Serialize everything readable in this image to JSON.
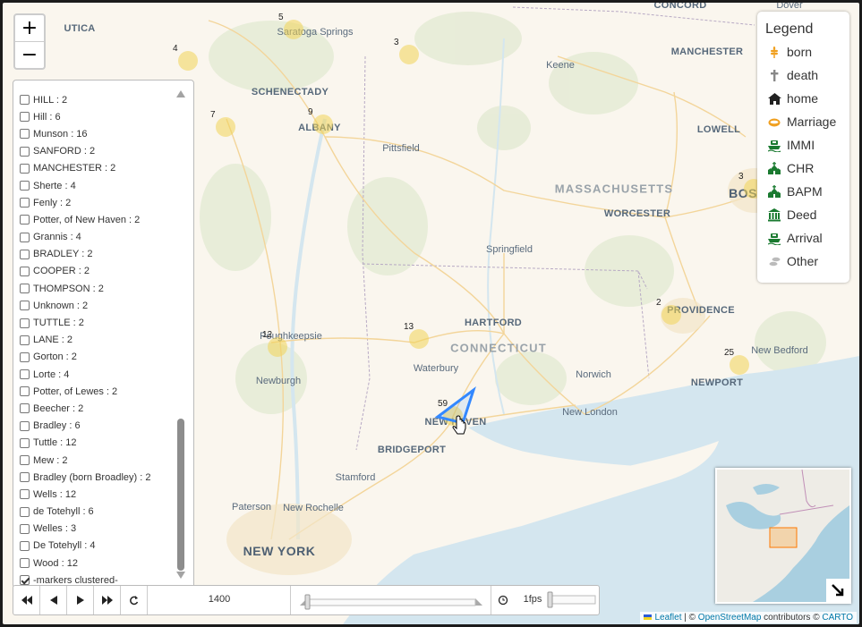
{
  "map": {
    "places": [
      {
        "id": "concord",
        "label": "CONCORD",
        "type": "big"
      },
      {
        "id": "utica",
        "label": "UTICA",
        "type": "big"
      },
      {
        "id": "saratoga-springs",
        "label": "Saratoga Springs",
        "type": "city"
      },
      {
        "id": "manchester",
        "label": "MANCHESTER",
        "type": "big"
      },
      {
        "id": "keene",
        "label": "Keene",
        "type": "city"
      },
      {
        "id": "schenectady",
        "label": "SCHENECTADY",
        "type": "big"
      },
      {
        "id": "albany",
        "label": "ALBANY",
        "type": "big"
      },
      {
        "id": "lowell",
        "label": "LOWELL",
        "type": "big"
      },
      {
        "id": "pittsfield",
        "label": "Pittsfield",
        "type": "city"
      },
      {
        "id": "massachusetts",
        "label": "MASSACHUSETTS",
        "type": "state"
      },
      {
        "id": "worcester",
        "label": "WORCESTER",
        "type": "big"
      },
      {
        "id": "bos",
        "label": "BOS",
        "type": "huge"
      },
      {
        "id": "springfield",
        "label": "Springfield",
        "type": "city"
      },
      {
        "id": "hartford",
        "label": "HARTFORD",
        "type": "big"
      },
      {
        "id": "providence",
        "label": "PROVIDENCE",
        "type": "big"
      },
      {
        "id": "poughkeepsie",
        "label": "Poughkeepsie",
        "type": "city"
      },
      {
        "id": "connecticut",
        "label": "CONNECTICUT",
        "type": "state"
      },
      {
        "id": "new-bedford",
        "label": "New Bedford",
        "type": "city"
      },
      {
        "id": "waterbury",
        "label": "Waterbury",
        "type": "city"
      },
      {
        "id": "newburgh",
        "label": "Newburgh",
        "type": "city"
      },
      {
        "id": "norwich",
        "label": "Norwich",
        "type": "city"
      },
      {
        "id": "newport",
        "label": "NEWPORT",
        "type": "big"
      },
      {
        "id": "new-haven",
        "label": "NEW HAVEN",
        "type": "big"
      },
      {
        "id": "new-london",
        "label": "New London",
        "type": "city"
      },
      {
        "id": "bridgeport",
        "label": "BRIDGEPORT",
        "type": "big"
      },
      {
        "id": "stamford",
        "label": "Stamford",
        "type": "city"
      },
      {
        "id": "paterson",
        "label": "Paterson",
        "type": "city"
      },
      {
        "id": "new-rochelle",
        "label": "New Rochelle",
        "type": "city"
      },
      {
        "id": "new-york",
        "label": "NEW YORK",
        "type": "huge"
      },
      {
        "id": "dover",
        "label": "Dover",
        "type": "city"
      }
    ],
    "clusters": [
      {
        "id": "saratoga",
        "count": "5"
      },
      {
        "id": "north",
        "count": "3"
      },
      {
        "id": "west-ny",
        "count": "4"
      },
      {
        "id": "albany-w",
        "count": "7"
      },
      {
        "id": "albany",
        "count": "9"
      },
      {
        "id": "boston",
        "count": "3"
      },
      {
        "id": "providence",
        "count": "2"
      },
      {
        "id": "hartford-s",
        "count": "13"
      },
      {
        "id": "poughkeepsie",
        "count": "12"
      },
      {
        "id": "newport",
        "count": "25"
      },
      {
        "id": "new-haven",
        "count": "59"
      }
    ]
  },
  "zoom": {
    "in_label": "+",
    "out_label": "−"
  },
  "layers": {
    "items": [
      {
        "label": "HILL : 2",
        "checked": false
      },
      {
        "label": "Hill : 6",
        "checked": false
      },
      {
        "label": "Munson : 16",
        "checked": false
      },
      {
        "label": "SANFORD : 2",
        "checked": false
      },
      {
        "label": "MANCHESTER : 2",
        "checked": false
      },
      {
        "label": "Sherte : 4",
        "checked": false
      },
      {
        "label": "Fenly : 2",
        "checked": false
      },
      {
        "label": "Potter, of New Haven : 2",
        "checked": false
      },
      {
        "label": "Grannis : 4",
        "checked": false
      },
      {
        "label": "BRADLEY : 2",
        "checked": false
      },
      {
        "label": "COOPER : 2",
        "checked": false
      },
      {
        "label": "THOMPSON : 2",
        "checked": false
      },
      {
        "label": "Unknown : 2",
        "checked": false
      },
      {
        "label": "TUTTLE : 2",
        "checked": false
      },
      {
        "label": "LANE : 2",
        "checked": false
      },
      {
        "label": "Gorton : 2",
        "checked": false
      },
      {
        "label": "Lorte : 4",
        "checked": false
      },
      {
        "label": "Potter, of Lewes : 2",
        "checked": false
      },
      {
        "label": "Beecher : 2",
        "checked": false
      },
      {
        "label": "Bradley : 6",
        "checked": false
      },
      {
        "label": "Tuttle : 12",
        "checked": false
      },
      {
        "label": "Mew : 2",
        "checked": false
      },
      {
        "label": "Bradley (born Broadley) : 2",
        "checked": false
      },
      {
        "label": "Wells : 12",
        "checked": false
      },
      {
        "label": "de Totehyll : 6",
        "checked": false
      },
      {
        "label": "Welles : 3",
        "checked": false
      },
      {
        "label": "De Totehyll : 4",
        "checked": false
      },
      {
        "label": "Wood : 12",
        "checked": false
      },
      {
        "label": "-markers clustered-",
        "checked": true
      }
    ]
  },
  "legend": {
    "title": "Legend",
    "entries": [
      {
        "label": "born",
        "icon": "wheat-icon",
        "color": "#f0a020"
      },
      {
        "label": "death",
        "icon": "cross-icon",
        "color": "#888888"
      },
      {
        "label": "home",
        "icon": "house-icon",
        "color": "#222222"
      },
      {
        "label": "Marriage",
        "icon": "ring-icon",
        "color": "#f0a020"
      },
      {
        "label": "IMMI",
        "icon": "ship-icon",
        "color": "#1a7a30"
      },
      {
        "label": "CHR",
        "icon": "church-icon",
        "color": "#1a7a30"
      },
      {
        "label": "BAPM",
        "icon": "church-icon",
        "color": "#1a7a30"
      },
      {
        "label": "Deed",
        "icon": "bank-icon",
        "color": "#1a7a30"
      },
      {
        "label": "Arrival",
        "icon": "ship-icon",
        "color": "#1a7a30"
      },
      {
        "label": "Other",
        "icon": "footprints-icon",
        "color": "#bbbbbb"
      }
    ]
  },
  "timeline": {
    "year": "1400",
    "fps": "1fps",
    "year_fraction": 0.0,
    "fps_fraction": 0.0
  },
  "attribution": {
    "leaflet": "Leaflet",
    "sep": " | © ",
    "osm": "OpenStreetMap",
    "contrib": " contributors © ",
    "carto": "CARTO"
  },
  "colors": {
    "cluster": "#f1d357",
    "water": "#d4e6ef",
    "land": "#faf6ee",
    "accent": "#3388ff"
  }
}
